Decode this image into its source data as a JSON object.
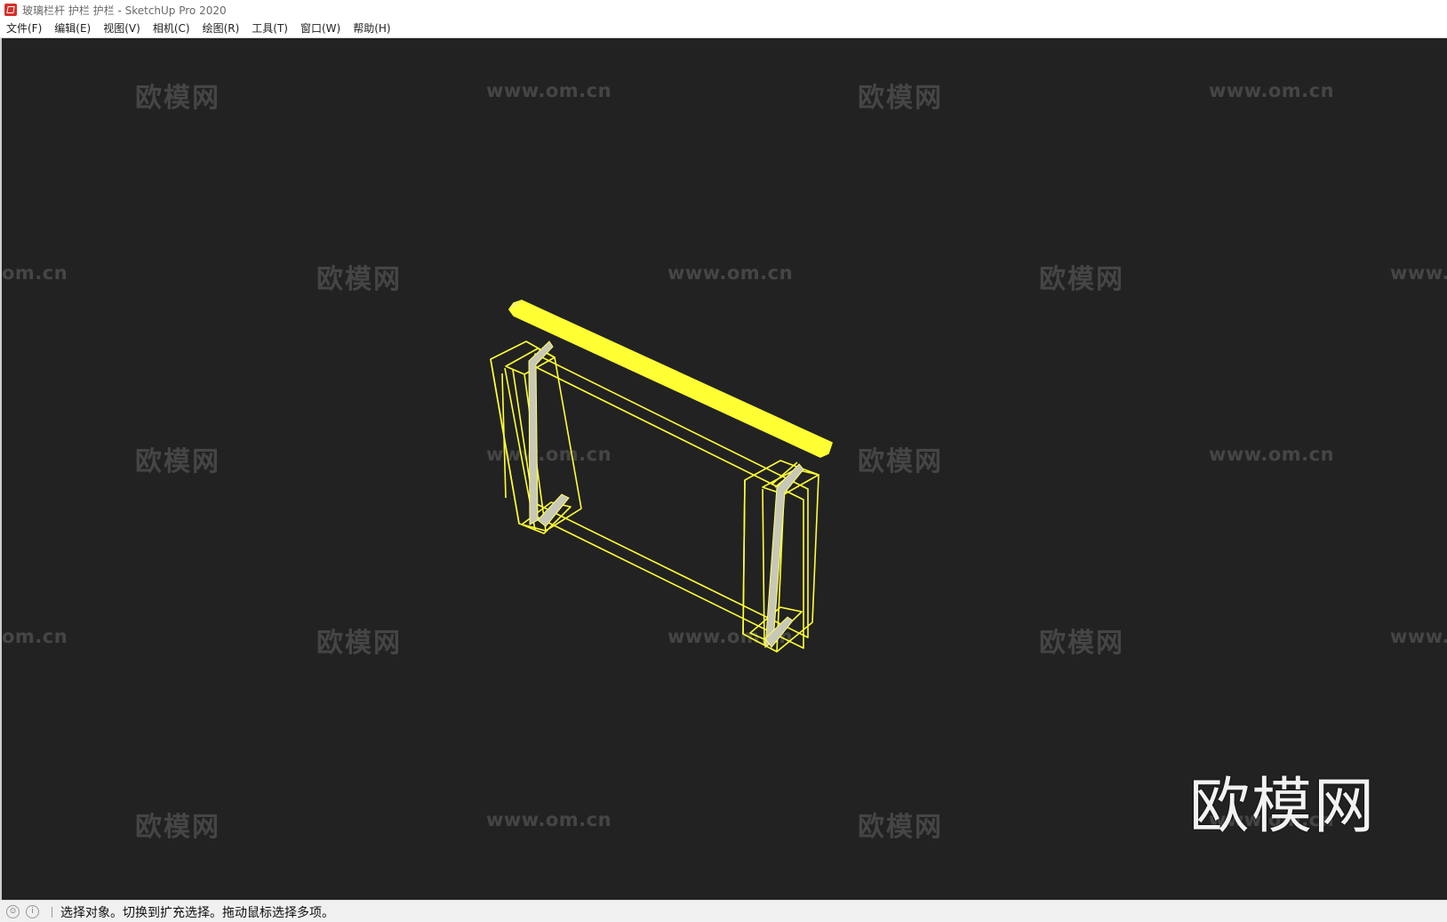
{
  "window": {
    "title": "玻璃栏杆 护栏 护栏 - SketchUp Pro 2020"
  },
  "menu": {
    "items": [
      "文件(F)",
      "编辑(E)",
      "视图(V)",
      "相机(C)",
      "绘图(R)",
      "工具(T)",
      "窗口(W)",
      "帮助(H)"
    ]
  },
  "watermark": {
    "cn": "欧模网",
    "en": "www.om.cn",
    "en_partial_left": "om.cn",
    "en_partial_right": "www."
  },
  "status": {
    "message": "选择对象。切换到扩充选择。拖动鼠标选择多项。",
    "icon_1": "geo-location-icon",
    "icon_2": "info-icon"
  },
  "colors": {
    "viewport_bg": "#222222",
    "selection": "#ffff33"
  }
}
